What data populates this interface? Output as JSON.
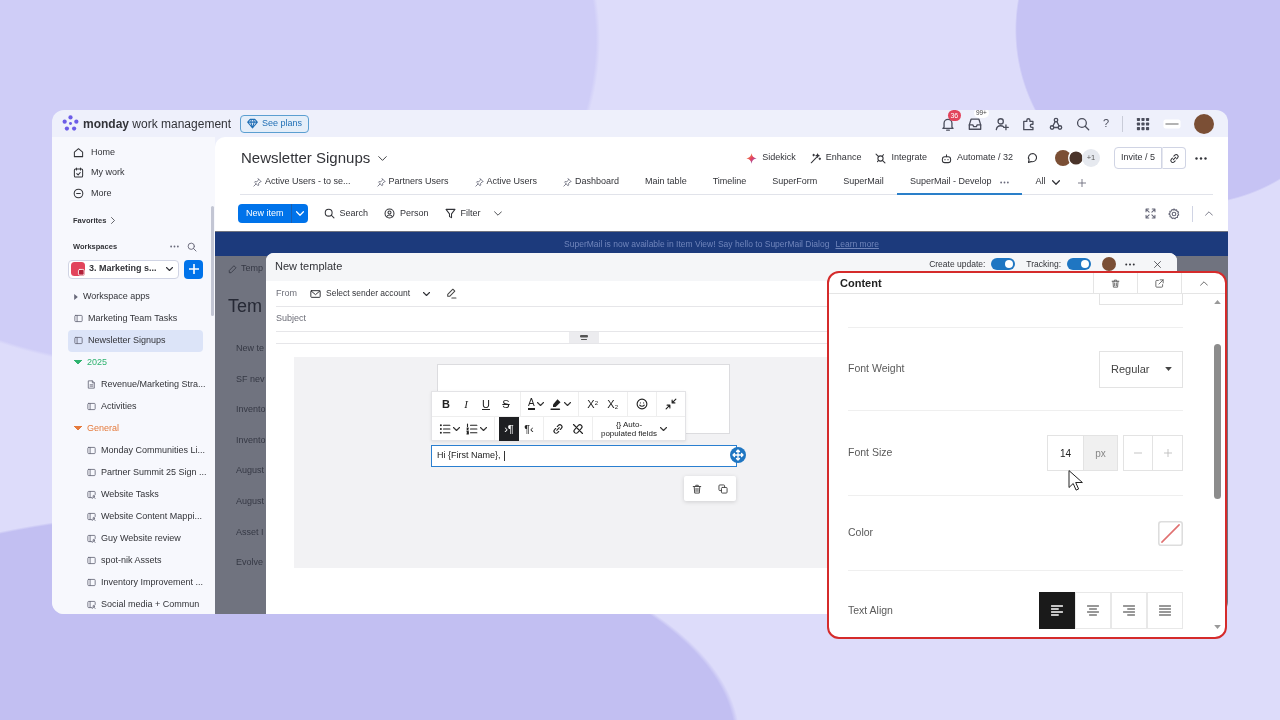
{
  "app_bar": {
    "brand": "**monday** work management",
    "plans_button": "See plans",
    "notifications_badge": "36",
    "inbox_badge": "99+",
    "help": "?"
  },
  "sidebar": {
    "nav": [
      {
        "label": "Home",
        "kind": "home"
      },
      {
        "label": "My work",
        "kind": "my-work"
      },
      {
        "label": "More",
        "kind": "more"
      }
    ],
    "favorites": "Favorites",
    "workspaces": "Workspaces",
    "workspace": "3. Marketing s...",
    "tree": [
      {
        "label": "Workspace apps",
        "kind": "section",
        "expanded": false,
        "selected": false
      },
      {
        "label": "Marketing Team Tasks",
        "kind": "board",
        "selected": false
      },
      {
        "label": "Newsletter Signups",
        "kind": "board",
        "selected": true
      },
      {
        "label": "2025",
        "kind": "folder",
        "color": "#2fb36f",
        "expanded": true,
        "selected": false,
        "children": [
          {
            "label": "Revenue/Marketing Stra...",
            "kind": "doc",
            "selected": false
          },
          {
            "label": "Activities",
            "kind": "board",
            "selected": false
          }
        ]
      },
      {
        "label": "General",
        "kind": "folder",
        "color": "#e57a3c",
        "expanded": true,
        "selected": false,
        "children": [
          {
            "label": "Monday Communities Li...",
            "kind": "board",
            "selected": false
          },
          {
            "label": "Partner Summit 25 Sign ...",
            "kind": "board",
            "selected": false
          },
          {
            "label": "Website Tasks",
            "kind": "shared-board",
            "selected": false
          },
          {
            "label": "Website Content Mappi...",
            "kind": "shared-board",
            "selected": false
          },
          {
            "label": "Guy Website review",
            "kind": "shared-board",
            "selected": false
          },
          {
            "label": "spot-nik Assets",
            "kind": "board",
            "selected": false
          },
          {
            "label": "Inventory Improvement ...",
            "kind": "board",
            "selected": false
          },
          {
            "label": "Social media + Commun",
            "kind": "shared-board",
            "selected": false
          }
        ]
      }
    ]
  },
  "board": {
    "title": "Newsletter Signups",
    "actions": [
      {
        "label": "Sidekick",
        "kind": "sidekick"
      },
      {
        "label": "Enhance",
        "kind": "enhance"
      },
      {
        "label": "Integrate",
        "kind": "integrate"
      },
      {
        "label": "Automate / 32",
        "kind": "automate"
      }
    ],
    "members_extra": "+1",
    "invite_button": "Invite / 5",
    "views": [
      {
        "label": "Active Users - to se...",
        "pinned": true,
        "selected": false
      },
      {
        "label": "Partners Users",
        "pinned": true,
        "selected": false
      },
      {
        "label": "Active Users",
        "pinned": true,
        "selected": false
      },
      {
        "label": "Dashboard",
        "pinned": true,
        "selected": false
      },
      {
        "label": "Main table",
        "pinned": false,
        "selected": false
      },
      {
        "label": "Timeline",
        "pinned": false,
        "selected": false
      },
      {
        "label": "SuperForm",
        "pinned": false,
        "selected": false
      },
      {
        "label": "SuperMail",
        "pinned": false,
        "selected": false
      },
      {
        "label": "SuperMail - Develop",
        "pinned": false,
        "selected": true
      }
    ],
    "views_all": "All",
    "new_item_button": "New item",
    "tools": [
      {
        "label": "Search",
        "kind": "search",
        "dropdown": false
      },
      {
        "label": "Person",
        "kind": "person",
        "dropdown": false
      },
      {
        "label": "Filter",
        "kind": "filter",
        "dropdown": true
      }
    ]
  },
  "banner": {
    "text": "SuperMail is now available in Item View! Say hello to SuperMail Dialog",
    "link": "Learn more"
  },
  "page_behind": {
    "tab": "Temp",
    "heading": "Tem",
    "rows": [
      "New te",
      "SF nev",
      "Invento",
      "Invento",
      "August",
      "August",
      "Asset I",
      "Evolve"
    ]
  },
  "template_modal": {
    "title": "New template",
    "toggles": [
      {
        "label": "Create update:",
        "on": true
      },
      {
        "label": "Tracking:",
        "on": true
      }
    ],
    "from_label": "From",
    "sender": "Select sender account",
    "subject_placeholder": "Subject",
    "toolbar": [
      [
        [
          {
            "kind": "bold",
            "label": "B",
            "active": false
          },
          {
            "kind": "italic",
            "label": "I",
            "active": false
          },
          {
            "kind": "underline",
            "label": "U",
            "active": false
          },
          {
            "kind": "strike",
            "label": "S",
            "active": false
          }
        ],
        [
          {
            "kind": "text-color",
            "label": "A",
            "active": false,
            "dropdown": true
          },
          {
            "kind": "highlight",
            "active": false,
            "dropdown": true
          }
        ],
        [
          {
            "kind": "superscript",
            "label": "X$^{2}$",
            "active": false
          },
          {
            "kind": "subscript",
            "label": "X$_{2}$",
            "active": false
          }
        ],
        [
          {
            "kind": "emoji",
            "active": false
          }
        ],
        [
          {
            "kind": "collapse",
            "active": false
          }
        ]
      ],
      [
        [
          {
            "kind": "bullet-list",
            "active": false,
            "dropdown": true
          },
          {
            "kind": "numbered-list",
            "active": false,
            "dropdown": true
          }
        ],
        [
          {
            "kind": "ltr",
            "label": "›¶",
            "active": true
          },
          {
            "kind": "rtl",
            "label": "¶‹",
            "active": false
          }
        ],
        [
          {
            "kind": "link",
            "active": false
          },
          {
            "kind": "unlink",
            "active": false
          }
        ],
        [
          {
            "kind": "auto-fields",
            "label": "{} Auto-populated fields",
            "active": false,
            "dropdown": true
          }
        ]
      ]
    ],
    "text_block": "Hi {First Name},"
  },
  "content_panel": {
    "title": "Content",
    "rows": [
      {
        "kind": "select",
        "label": "Font Weight",
        "value": "Regular"
      },
      {
        "kind": "number",
        "label": "Font Size",
        "value": "14",
        "unit": "px"
      },
      {
        "kind": "color",
        "label": "Color"
      },
      {
        "kind": "align",
        "label": "Text Align",
        "options": [
          {
            "kind": "left",
            "selected": true
          },
          {
            "kind": "center",
            "selected": false
          },
          {
            "kind": "right",
            "selected": false
          },
          {
            "kind": "justify",
            "selected": false
          }
        ]
      }
    ]
  }
}
